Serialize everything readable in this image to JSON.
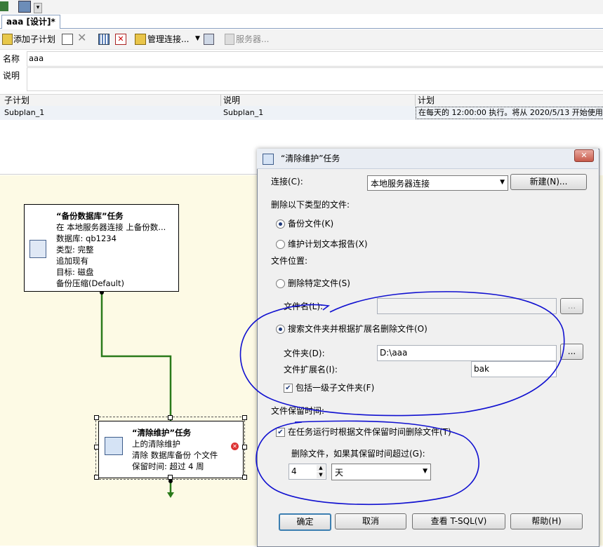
{
  "designer_tab": {
    "label": "aaa [设计]*"
  },
  "toolbar": {
    "add_subplan": "添加子计划",
    "manage_connections": "管理连接...",
    "servers": "服务器..."
  },
  "properties": {
    "name_label": "名称",
    "name_value": "aaa",
    "description_label": "说明",
    "description_value": ""
  },
  "subplan_grid": {
    "headers": [
      "子计划",
      "说明",
      "计划"
    ],
    "rows": [
      [
        "Subplan_1",
        "Subplan_1",
        "在每天的 12:00:00 执行。将从 2020/5/13 开始使用"
      ]
    ]
  },
  "tasks": {
    "backup": {
      "title": "“备份数据库”任务",
      "lines": [
        "在 本地服务器连接 上备份数...",
        "数据库: qb1234",
        "类型: 完整",
        "追加现有",
        "目标: 磁盘",
        "备份压缩(Default)"
      ]
    },
    "cleanup": {
      "title": "“清除维护”任务",
      "lines": [
        "上的清除维护",
        "清除 数据库备份 个文件",
        "保留时间: 超过 4 周"
      ]
    }
  },
  "dialog": {
    "title": "“清除维护”任务",
    "connection_label": "连接(C):",
    "connection_value": "本地服务器连接",
    "new_button": "新建(N)...",
    "file_type_group": "删除以下类型的文件:",
    "radio_backup": "备份文件(K)",
    "radio_report": "维护计划文本报告(X)",
    "file_location_group": "文件位置:",
    "radio_specific": "删除特定文件(S)",
    "filename_label": "文件名(L):",
    "filename_value": "",
    "browse1": "...",
    "radio_search": "搜索文件夹并根据扩展名删除文件(O)",
    "folder_label": "文件夹(D):",
    "folder_value": "D:\\aaa",
    "browse2": "...",
    "ext_label": "文件扩展名(I):",
    "ext_value": "bak",
    "include_sub": "包括一级子文件夹(F)",
    "retention_group": "文件保留时间:",
    "retention_check": "在任务运行时根据文件保留时间删除文件(T)",
    "retention_sub": "删除文件，如果其保留时间超过(G):",
    "retention_value": "4",
    "retention_unit": "天",
    "ok": "确定",
    "cancel": "取消",
    "tsql": "查看 T-SQL(V)",
    "help": "帮助(H)"
  },
  "colors": {
    "annotation_ink": "#1010d0",
    "designer_bg": "#fdfae5",
    "connector": "#2a7a1a"
  }
}
